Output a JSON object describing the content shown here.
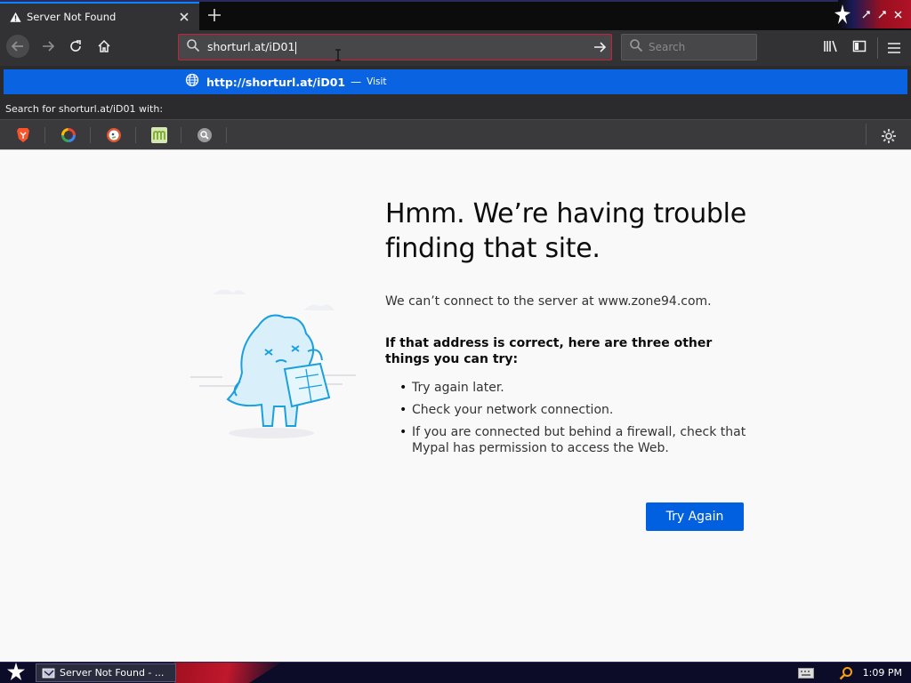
{
  "tab": {
    "title": "Server Not Found",
    "icon": "warning-icon"
  },
  "window": {
    "accent_colors": [
      "#1a1a55",
      "#b01226"
    ]
  },
  "urlbar": {
    "value": "shorturl.at/iD01"
  },
  "searchbar": {
    "placeholder": "Search"
  },
  "suggestion": {
    "url": "http://shorturl.at/iD01",
    "separator": "—",
    "action": "Visit"
  },
  "search_with": {
    "label": "Search for shorturl.at/iD01 with:"
  },
  "engines": [
    {
      "name": "brave",
      "icon": "brave-icon"
    },
    {
      "name": "google",
      "icon": "google-icon"
    },
    {
      "name": "duckduckgo",
      "icon": "duckduckgo-icon"
    },
    {
      "name": "mojeek",
      "icon": "mojeek-icon"
    },
    {
      "name": "other",
      "icon": "magnifier-icon"
    }
  ],
  "error_page": {
    "title": "Hmm. We’re having trouble finding that site.",
    "description": "We can’t connect to the server at www.zone94.com.",
    "tips_title": "If that address is correct, here are three other things you can try:",
    "tips": [
      "Try again later.",
      "Check your network connection.",
      "If you are connected but behind a firewall, check that Mypal has permission to access the Web."
    ],
    "button": "Try Again"
  },
  "taskbar": {
    "task_label": "Server Not Found - ...",
    "clock": "1:09 PM"
  },
  "colors": {
    "accent": "#0060df",
    "urlbar_border": "#c6203a",
    "suggest_bg": "#0a63e0"
  }
}
